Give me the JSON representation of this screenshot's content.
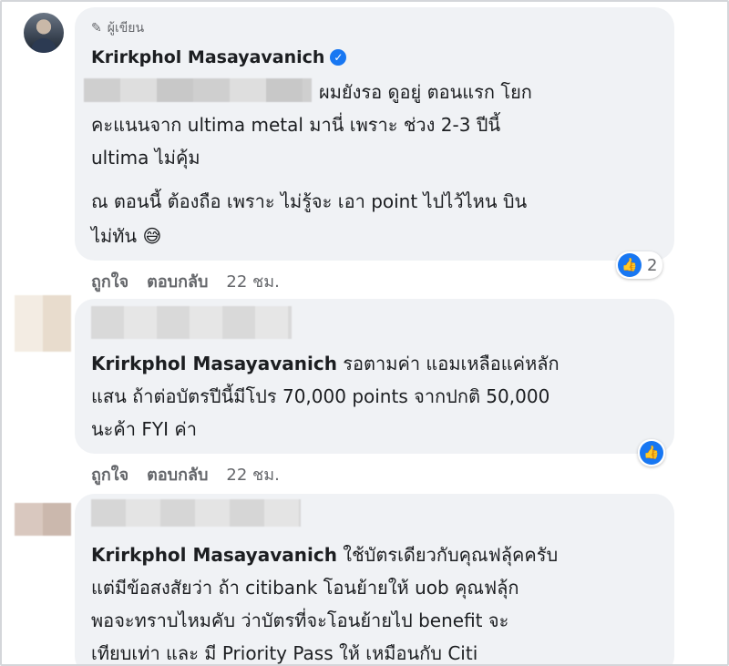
{
  "comment1": {
    "author_tag": "ผู้เขียน",
    "name": "Krirkphol Masayavanich",
    "line1": "ผมยังรอ ดูอยู่ ตอนแรก โยก",
    "line2": "คะแนนจาก ultima metal มานี่ เพราะ ช่วง 2-3 ปีนี้",
    "line3": "ultima ไม่คุ้ม",
    "line4": "ณ ตอนนี้ ต้องถือ เพราะ ไม่รู้จะ เอา point ไปไว้ไหน บิน",
    "line5": "ไม่ทัน 😅",
    "like": "ถูกใจ",
    "reply": "ตอบกลับ",
    "time": "22 ชม.",
    "reaction_count": "2"
  },
  "comment2": {
    "name": "Krirkphol Masayavanich",
    "line1": "รอตามค่า แอมเหลือแค่หลัก",
    "line2": "แสน ถ้าต่อบัตรปีนี้มีโปร 70,000 points จากปกติ 50,000",
    "line3": "นะค้า FYI ค่า",
    "like": "ถูกใจ",
    "reply": "ตอบกลับ",
    "time": "22 ชม."
  },
  "comment3": {
    "name": "Krirkphol Masayavanich",
    "line1": "ใช้บัตรเดียวกับคุณฟลุ้คครับ",
    "line2": "แต่มีข้อสงสัยว่า ถ้า citibank โอนย้ายให้ uob คุณฟลุ้ก",
    "line3": "พอจะทราบไหมคับ ว่าบัตรที่จะโอนย้ายไป benefit จะ",
    "line4": "เทียบเท่า และ มี Priority Pass ให้ เหมือนกับ Citi"
  },
  "icons": {
    "verified": "verified-badge-icon",
    "like": "thumbs-up-icon",
    "pen": "pen-icon"
  },
  "colors": {
    "accent": "#1877f2",
    "bubble": "#f0f2f5",
    "meta": "#65676b"
  }
}
